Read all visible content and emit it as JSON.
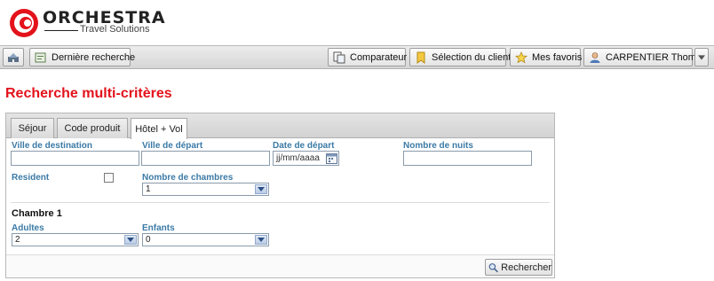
{
  "brand": {
    "name": "ORCHESTRA",
    "tagline": "Travel Solutions",
    "accent": "#e3121b"
  },
  "toolbar": {
    "last_search": "Dernière recherche",
    "comparator": "Comparateur",
    "client_selection": "Sélection du client",
    "favorites": "Mes favoris",
    "user": "CARPENTIER Thomas"
  },
  "page": {
    "title": "Recherche multi-critères"
  },
  "tabs": [
    {
      "label": "Séjour",
      "active": false
    },
    {
      "label": "Code produit",
      "active": false
    },
    {
      "label": "Hôtel + Vol",
      "active": true
    }
  ],
  "form": {
    "destination": {
      "label": "Ville de destination",
      "value": ""
    },
    "departure_city": {
      "label": "Ville de départ",
      "value": ""
    },
    "departure_date": {
      "label": "Date de départ",
      "value": "jj/mm/aaaa"
    },
    "nights": {
      "label": "Nombre de nuits",
      "value": ""
    },
    "resident": {
      "label": "Resident",
      "checked": false
    },
    "rooms": {
      "label": "Nombre de chambres",
      "value": "1"
    },
    "room1": {
      "title": "Chambre 1",
      "adults": {
        "label": "Adultes",
        "value": "2"
      },
      "children": {
        "label": "Enfants",
        "value": "0"
      }
    },
    "search_button": "Rechercher"
  }
}
